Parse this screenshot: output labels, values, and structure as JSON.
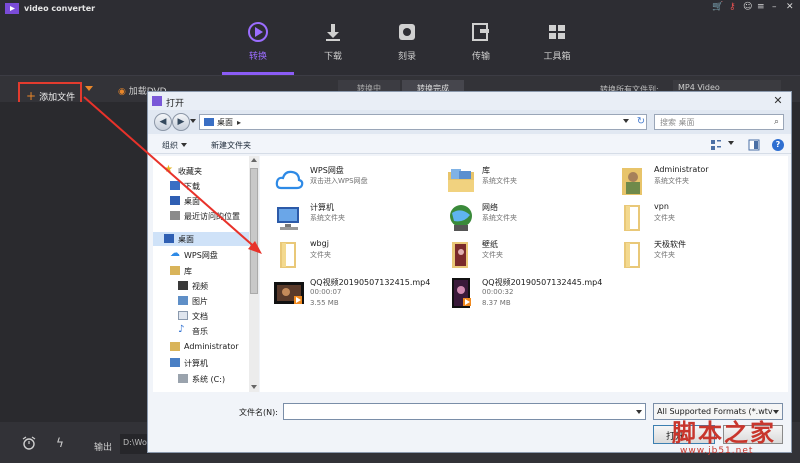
{
  "app": {
    "title": "video converter",
    "nav_tabs": [
      {
        "label": "转换",
        "icon": "convert-icon",
        "active": true
      },
      {
        "label": "下载",
        "icon": "download-icon"
      },
      {
        "label": "刻录",
        "icon": "burn-icon"
      },
      {
        "label": "传输",
        "icon": "transfer-icon"
      },
      {
        "label": "工具箱",
        "icon": "toolbox-icon"
      }
    ],
    "add_file_label": "添加文件",
    "load_dvd_label": "加载DVD",
    "segments": [
      "转换中",
      "转换完成"
    ],
    "convert_all_label": "转换所有文件到:",
    "format_value": "MP4 Video",
    "output_label": "输出",
    "output_path": "D:\\Wo",
    "accent_color": "#8b5cf6",
    "highlight_color": "#e23b2e"
  },
  "dialog": {
    "title": "打开",
    "address": "桌面",
    "search_placeholder": "搜索 桌面",
    "organize_label": "组织",
    "new_folder_label": "新建文件夹",
    "nav": [
      {
        "label": "收藏夹",
        "icon": "star-icon"
      },
      {
        "label": "下载",
        "icon": "downloads-icon"
      },
      {
        "label": "桌面",
        "icon": "desktop-icon"
      },
      {
        "label": "最近访问的位置",
        "icon": "recent-icon"
      },
      {
        "label": "桌面",
        "icon": "desktop-icon",
        "selected": true
      },
      {
        "label": "WPS网盘",
        "icon": "cloud-icon"
      },
      {
        "label": "库",
        "icon": "library-icon"
      },
      {
        "label": "视频",
        "icon": "video-icon"
      },
      {
        "label": "图片",
        "icon": "picture-icon"
      },
      {
        "label": "文档",
        "icon": "document-icon"
      },
      {
        "label": "音乐",
        "icon": "music-icon"
      },
      {
        "label": "Administrator",
        "icon": "user-icon"
      },
      {
        "label": "计算机",
        "icon": "computer-icon"
      },
      {
        "label": "系统 (C:)",
        "icon": "drive-icon"
      }
    ],
    "items": [
      {
        "name": "WPS网盘",
        "desc": "双击进入WPS网盘",
        "icon": "cloud-icon"
      },
      {
        "name": "库",
        "desc": "系统文件夹",
        "icon": "library-icon"
      },
      {
        "name": "Administrator",
        "desc": "系统文件夹",
        "icon": "user-folder-icon"
      },
      {
        "name": "计算机",
        "desc": "系统文件夹",
        "icon": "computer-icon"
      },
      {
        "name": "网络",
        "desc": "系统文件夹",
        "icon": "network-icon"
      },
      {
        "name": "vpn",
        "desc": "文件夹",
        "icon": "folder-icon"
      },
      {
        "name": "wbgj",
        "desc": "文件夹",
        "icon": "folder-icon"
      },
      {
        "name": "壁纸",
        "desc": "文件夹",
        "icon": "wallpaper-folder-icon"
      },
      {
        "name": "天极软件",
        "desc": "文件夹",
        "icon": "folder-icon"
      },
      {
        "name": "QQ视频20190507132415.mp4",
        "desc": "00:00:07",
        "size": "3.55 MB",
        "icon": "video-thumb-icon"
      },
      {
        "name": "QQ视频20190507132445.mp4",
        "desc": "00:00:32",
        "size": "8.37 MB",
        "icon": "video-thumb-icon"
      }
    ],
    "filename_label": "文件名(N):",
    "filename_value": "",
    "filter_value": "All Supported Formats (*.wtv",
    "open_label": "打开"
  },
  "watermark": {
    "text": "脚本之家",
    "url": "www.jb51.net"
  }
}
